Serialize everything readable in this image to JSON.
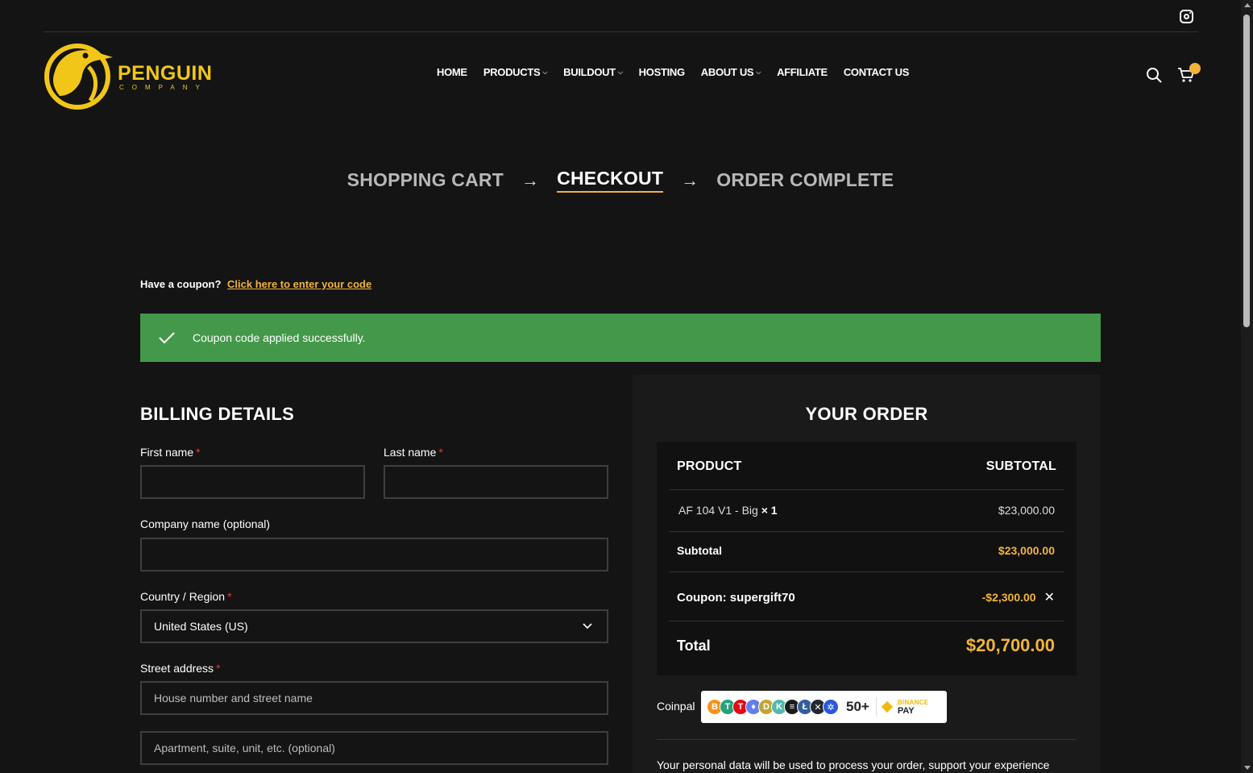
{
  "header": {
    "logo_main": "PENGUIN",
    "logo_sub": "COMPANY",
    "nav": [
      {
        "label": "HOME",
        "has_dropdown": false
      },
      {
        "label": "PRODUCTS",
        "has_dropdown": true
      },
      {
        "label": "BUILDOUT",
        "has_dropdown": true
      },
      {
        "label": "HOSTING",
        "has_dropdown": false
      },
      {
        "label": "ABOUT US",
        "has_dropdown": true
      },
      {
        "label": "AFFILIATE",
        "has_dropdown": false
      },
      {
        "label": "CONTACT US",
        "has_dropdown": false
      }
    ],
    "icons": [
      "instagram-icon",
      "search-icon",
      "cart-icon"
    ]
  },
  "steps": {
    "cart": "SHOPPING CART",
    "checkout": "CHECKOUT",
    "complete": "ORDER COMPLETE",
    "arrow": "→"
  },
  "coupon": {
    "prompt": "Have a coupon?",
    "link": "Click here to enter your code"
  },
  "notice": {
    "text": "Coupon code applied successfully."
  },
  "billing": {
    "title": "BILLING DETAILS",
    "first_name_label": "First name",
    "last_name_label": "Last name",
    "company_label": "Company name (optional)",
    "country_label": "Country / Region",
    "country_value": "United States (US)",
    "street_label": "Street address",
    "street_placeholder": "House number and street name",
    "apartment_placeholder": "Apartment, suite, unit, etc. (optional)",
    "required_mark": "*"
  },
  "order": {
    "title": "YOUR ORDER",
    "col_product": "PRODUCT",
    "col_subtotal": "SUBTOTAL",
    "item_name": "AF 104 V1 - Big",
    "item_qty": "× 1",
    "item_price": "$23,000.00",
    "subtotal_label": "Subtotal",
    "subtotal_value": "$23,000.00",
    "coupon_label": "Coupon: supergift70",
    "coupon_value": "-$2,300.00",
    "remove": "✕",
    "total_label": "Total",
    "total_value": "$20,700.00"
  },
  "payment": {
    "label": "Coinpal",
    "coins": [
      "B",
      "T",
      "T",
      "♦",
      "D",
      "K",
      "≡",
      "Ł",
      "✕",
      "✲"
    ],
    "more": "50+",
    "binance_top": "BINANCE",
    "binance_bottom": "PAY"
  },
  "privacy": {
    "text": "Your personal data will be used to process your order, support your experience"
  },
  "colors": {
    "accent": "#f2b43a",
    "logo": "#f2c618",
    "success": "#44984a",
    "background": "#141414"
  }
}
